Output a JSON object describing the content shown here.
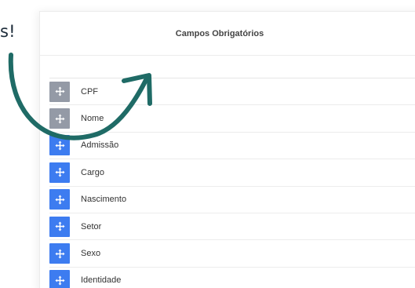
{
  "callout": {
    "text": "s!"
  },
  "panel": {
    "title": "Campos Obrigatórios"
  },
  "fields": [
    {
      "label": "CPF",
      "handle": "required"
    },
    {
      "label": "Nome",
      "handle": "required"
    },
    {
      "label": "Admissão",
      "handle": "optional"
    },
    {
      "label": "Cargo",
      "handle": "optional"
    },
    {
      "label": "Nascimento",
      "handle": "optional"
    },
    {
      "label": "Setor",
      "handle": "optional"
    },
    {
      "label": "Sexo",
      "handle": "optional"
    },
    {
      "label": "Identidade",
      "handle": "optional"
    }
  ],
  "colors": {
    "required_handle": "#949aa6",
    "optional_handle": "#3d7cf0",
    "arrow": "#1f6b66"
  },
  "icons": {
    "handle": "move-icon"
  }
}
